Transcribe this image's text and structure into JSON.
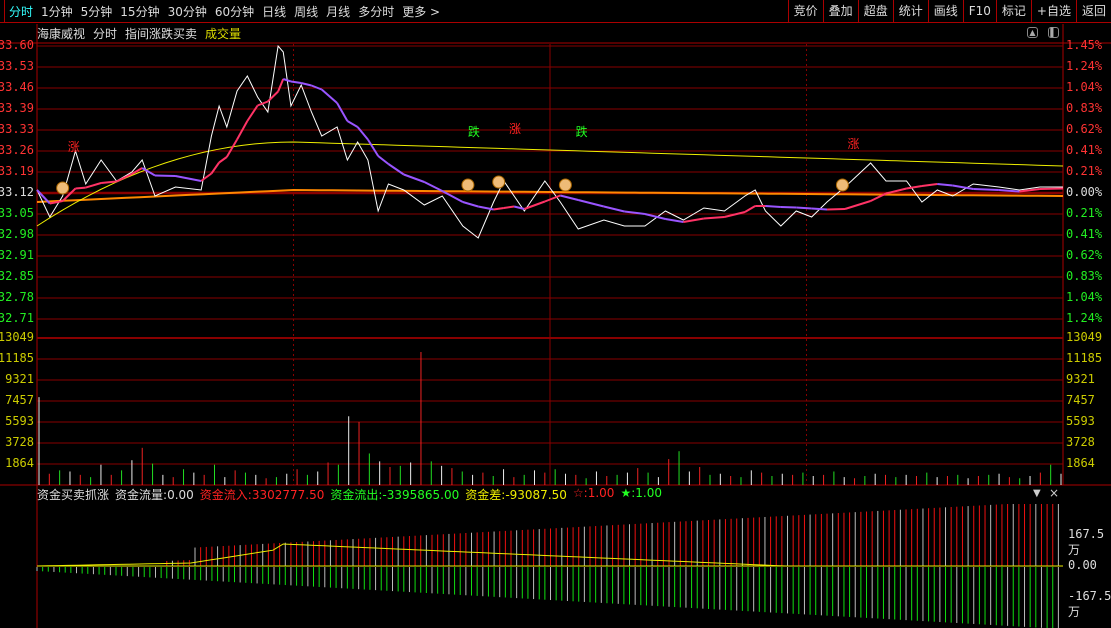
{
  "periods": [
    "分时",
    "1分钟",
    "5分钟",
    "15分钟",
    "30分钟",
    "60分钟",
    "日线",
    "周线",
    "月线",
    "多分时",
    "更多 >"
  ],
  "tools": [
    "竞价",
    "叠加",
    "超盘",
    "统计",
    "画线",
    "F10",
    "标记",
    "+自选",
    "返回"
  ],
  "title": {
    "stock": "海康威视",
    "mode": "分时",
    "indicator": "指间涨跌买卖",
    "volume": "成交量"
  },
  "price_axis": [
    "33.60",
    "33.53",
    "33.46",
    "33.39",
    "33.33",
    "33.26",
    "33.19",
    "33.12",
    "33.05",
    "32.98",
    "32.91",
    "32.85",
    "32.78",
    "32.71"
  ],
  "pct_axis": [
    "1.45%",
    "1.24%",
    "1.04%",
    "0.83%",
    "0.62%",
    "0.41%",
    "0.21%",
    "0.00%",
    "0.21%",
    "0.41%",
    "0.62%",
    "0.83%",
    "1.04%",
    "1.24%"
  ],
  "vol_axis": [
    "13049",
    "11185",
    "9321",
    "7457",
    "5593",
    "3728",
    "1864"
  ],
  "fund_axis": [
    "167.5万",
    "0.00",
    "-167.5万"
  ],
  "fund": {
    "name": "资金买卖抓涨",
    "flow_label": "资金流量:",
    "flow": "0.00",
    "in_label": "资金流入:",
    "in": "3302777.50",
    "out_label": "资金流出:",
    "out": "-3395865.00",
    "diff_label": "资金差:",
    "diff": "-93087.50",
    "star_red": "☆:1.00",
    "star_green": "★:1.00"
  },
  "signals": [
    {
      "t": "涨",
      "x": 0.03,
      "p": 33.25,
      "c": "#f22"
    },
    {
      "t": "跌",
      "x": 0.42,
      "p": 33.3,
      "c": "#2f2"
    },
    {
      "t": "涨",
      "x": 0.46,
      "p": 33.31,
      "c": "#f22"
    },
    {
      "t": "跌",
      "x": 0.525,
      "p": 33.3,
      "c": "#2f2"
    },
    {
      "t": "涨",
      "x": 0.79,
      "p": 33.26,
      "c": "#f22"
    }
  ],
  "chart_data": {
    "type": "line",
    "prev_close": 33.12,
    "price": [
      [
        0,
        33.12
      ],
      [
        5,
        33.03
      ],
      [
        10,
        33.1
      ],
      [
        15,
        33.25
      ],
      [
        19,
        33.14
      ],
      [
        25,
        33.22
      ],
      [
        31,
        33.15
      ],
      [
        37,
        33.18
      ],
      [
        41,
        33.22
      ],
      [
        46,
        33.1
      ],
      [
        54,
        33.13
      ],
      [
        64,
        33.12
      ],
      [
        68,
        33.3
      ],
      [
        71,
        33.4
      ],
      [
        74,
        33.33
      ],
      [
        78,
        33.45
      ],
      [
        82,
        33.5
      ],
      [
        86,
        33.43
      ],
      [
        90,
        33.38
      ],
      [
        94,
        33.6
      ],
      [
        96,
        33.58
      ],
      [
        99,
        33.4
      ],
      [
        103,
        33.47
      ],
      [
        107,
        33.38
      ],
      [
        111,
        33.3
      ],
      [
        117,
        33.33
      ],
      [
        121,
        33.22
      ],
      [
        125,
        33.28
      ],
      [
        129,
        33.22
      ],
      [
        133,
        33.05
      ],
      [
        137,
        33.14
      ],
      [
        143,
        33.12
      ],
      [
        151,
        33.07
      ],
      [
        158,
        33.1
      ],
      [
        166,
        33.0
      ],
      [
        172,
        32.96
      ],
      [
        178,
        33.08
      ],
      [
        182,
        33.15
      ],
      [
        186,
        33.1
      ],
      [
        190,
        33.05
      ],
      [
        198,
        33.15
      ],
      [
        204,
        33.08
      ],
      [
        211,
        32.99
      ],
      [
        221,
        33.02
      ],
      [
        229,
        33.0
      ],
      [
        237,
        33.0
      ],
      [
        245,
        33.05
      ],
      [
        252,
        33.02
      ],
      [
        260,
        33.06
      ],
      [
        268,
        33.05
      ],
      [
        276,
        33.1
      ],
      [
        280,
        33.12
      ],
      [
        284,
        33.05
      ],
      [
        290,
        33.0
      ],
      [
        296,
        33.05
      ],
      [
        302,
        33.03
      ],
      [
        308,
        33.08
      ],
      [
        315,
        33.13
      ],
      [
        325,
        33.21
      ],
      [
        331,
        33.15
      ],
      [
        339,
        33.15
      ],
      [
        345,
        33.08
      ],
      [
        351,
        33.12
      ],
      [
        357,
        33.1
      ],
      [
        365,
        33.14
      ],
      [
        375,
        33.13
      ],
      [
        383,
        33.12
      ],
      [
        391,
        33.13
      ],
      [
        400,
        33.13
      ]
    ],
    "volume": [
      7800,
      1000,
      1300,
      1200,
      900,
      700,
      1800,
      900,
      1300,
      2200,
      3300,
      1900,
      900,
      700,
      1400,
      1100,
      900,
      1800,
      700,
      1300,
      1100,
      900,
      600,
      700,
      1000,
      1400,
      900,
      1200,
      2000,
      1800,
      6100,
      5600,
      2800,
      2100,
      1600,
      1700,
      2000,
      11800,
      2100,
      1700,
      1500,
      1200,
      900,
      1100,
      800,
      1400,
      700,
      900,
      1300,
      1100,
      1400,
      1000,
      900,
      600,
      1200,
      800,
      900,
      1100,
      1500,
      1100,
      700,
      2300,
      3000,
      1200,
      1600,
      900,
      1000,
      800,
      700,
      1300,
      1100,
      800,
      1000,
      900,
      1100,
      800,
      900,
      1200,
      700,
      600,
      800,
      1000,
      900,
      700,
      900,
      800,
      1100,
      700,
      800,
      900,
      600,
      800,
      900,
      1000,
      700,
      600,
      800,
      1100,
      1800,
      1000
    ]
  }
}
